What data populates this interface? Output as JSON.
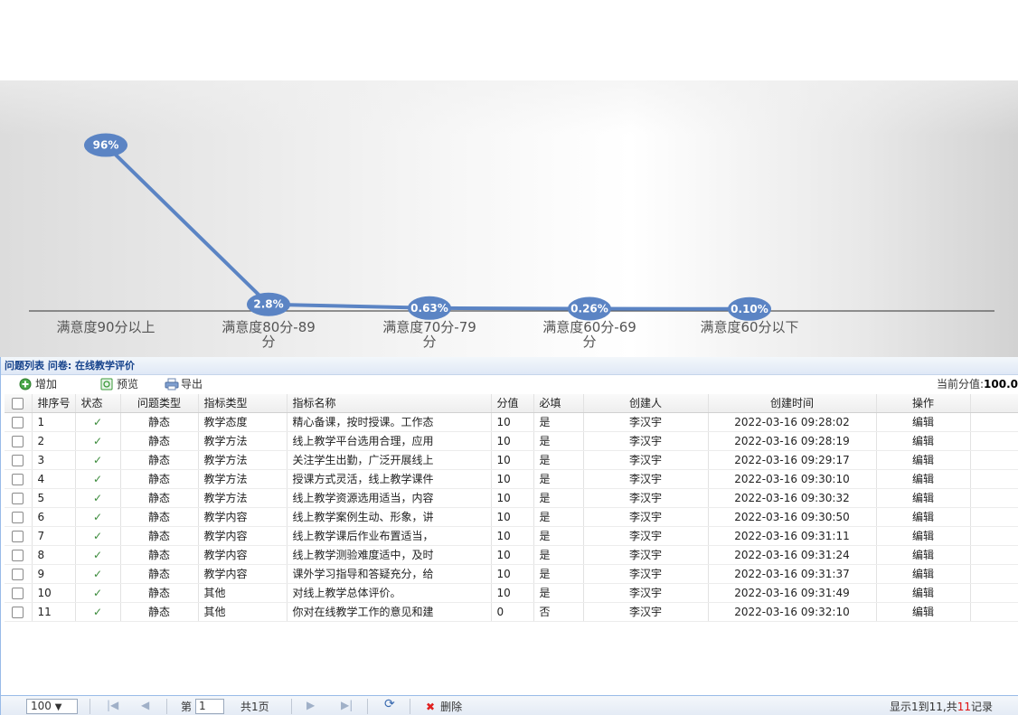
{
  "chart_data": {
    "type": "line",
    "categories": [
      "满意度90分以上",
      "满意度80分-89分",
      "满意度70分-79分",
      "满意度60分-69分",
      "满意度60分以下"
    ],
    "values": [
      96,
      2.8,
      0.63,
      0.26,
      0.1
    ],
    "data_labels": [
      "96%",
      "2.8%",
      "0.63%",
      "0.26%",
      "0.10%"
    ],
    "colors": {
      "line": "#5b84c4",
      "marker": "#5b84c4",
      "label_text": "#ffffff"
    }
  },
  "panel": {
    "title": "问题列表 问卷: 在线教学评价",
    "toolbar": {
      "add_label": "增加",
      "preview_label": "预览",
      "export_label": "导出",
      "score_prefix": "当前分值:",
      "score_value": "100.0"
    },
    "columns": [
      "排序号",
      "状态",
      "问题类型",
      "指标类型",
      "指标名称",
      "分值",
      "必填",
      "创建人",
      "创建时间",
      "操作"
    ],
    "rows": [
      {
        "order": "1",
        "status": "✓",
        "qtype": "静态",
        "itype": "教学态度",
        "name": "精心备课，按时授课。工作态",
        "score": "10",
        "required": "是",
        "creator": "李汉宇",
        "time": "2022-03-16 09:28:02",
        "op": "编辑"
      },
      {
        "order": "2",
        "status": "✓",
        "qtype": "静态",
        "itype": "教学方法",
        "name": "线上教学平台选用合理，应用",
        "score": "10",
        "required": "是",
        "creator": "李汉宇",
        "time": "2022-03-16 09:28:19",
        "op": "编辑"
      },
      {
        "order": "3",
        "status": "✓",
        "qtype": "静态",
        "itype": "教学方法",
        "name": "关注学生出勤，广泛开展线上",
        "score": "10",
        "required": "是",
        "creator": "李汉宇",
        "time": "2022-03-16 09:29:17",
        "op": "编辑"
      },
      {
        "order": "4",
        "status": "✓",
        "qtype": "静态",
        "itype": "教学方法",
        "name": "授课方式灵活，线上教学课件",
        "score": "10",
        "required": "是",
        "creator": "李汉宇",
        "time": "2022-03-16 09:30:10",
        "op": "编辑"
      },
      {
        "order": "5",
        "status": "✓",
        "qtype": "静态",
        "itype": "教学方法",
        "name": "线上教学资源选用适当，内容",
        "score": "10",
        "required": "是",
        "creator": "李汉宇",
        "time": "2022-03-16 09:30:32",
        "op": "编辑"
      },
      {
        "order": "6",
        "status": "✓",
        "qtype": "静态",
        "itype": "教学内容",
        "name": "线上教学案例生动、形象，讲",
        "score": "10",
        "required": "是",
        "creator": "李汉宇",
        "time": "2022-03-16 09:30:50",
        "op": "编辑"
      },
      {
        "order": "7",
        "status": "✓",
        "qtype": "静态",
        "itype": "教学内容",
        "name": "线上教学课后作业布置适当，",
        "score": "10",
        "required": "是",
        "creator": "李汉宇",
        "time": "2022-03-16 09:31:11",
        "op": "编辑"
      },
      {
        "order": "8",
        "status": "✓",
        "qtype": "静态",
        "itype": "教学内容",
        "name": "线上教学测验难度适中，及时",
        "score": "10",
        "required": "是",
        "creator": "李汉宇",
        "time": "2022-03-16 09:31:24",
        "op": "编辑"
      },
      {
        "order": "9",
        "status": "✓",
        "qtype": "静态",
        "itype": "教学内容",
        "name": "课外学习指导和答疑充分，给",
        "score": "10",
        "required": "是",
        "creator": "李汉宇",
        "time": "2022-03-16 09:31:37",
        "op": "编辑"
      },
      {
        "order": "10",
        "status": "✓",
        "qtype": "静态",
        "itype": "其他",
        "name": "对线上教学总体评价。",
        "score": "10",
        "required": "是",
        "creator": "李汉宇",
        "time": "2022-03-16 09:31:49",
        "op": "编辑"
      },
      {
        "order": "11",
        "status": "✓",
        "qtype": "静态",
        "itype": "其他",
        "name": "你对在线教学工作的意见和建",
        "score": "0",
        "required": "否",
        "creator": "李汉宇",
        "time": "2022-03-16 09:32:10",
        "op": "编辑"
      }
    ],
    "pager": {
      "page_size": "100",
      "page_prefix": "第",
      "page_value": "1",
      "page_total": "共1页",
      "delete_label": "删除",
      "info_prefix": "显示1到11,共",
      "info_count": "11",
      "info_suffix": "记录"
    }
  }
}
